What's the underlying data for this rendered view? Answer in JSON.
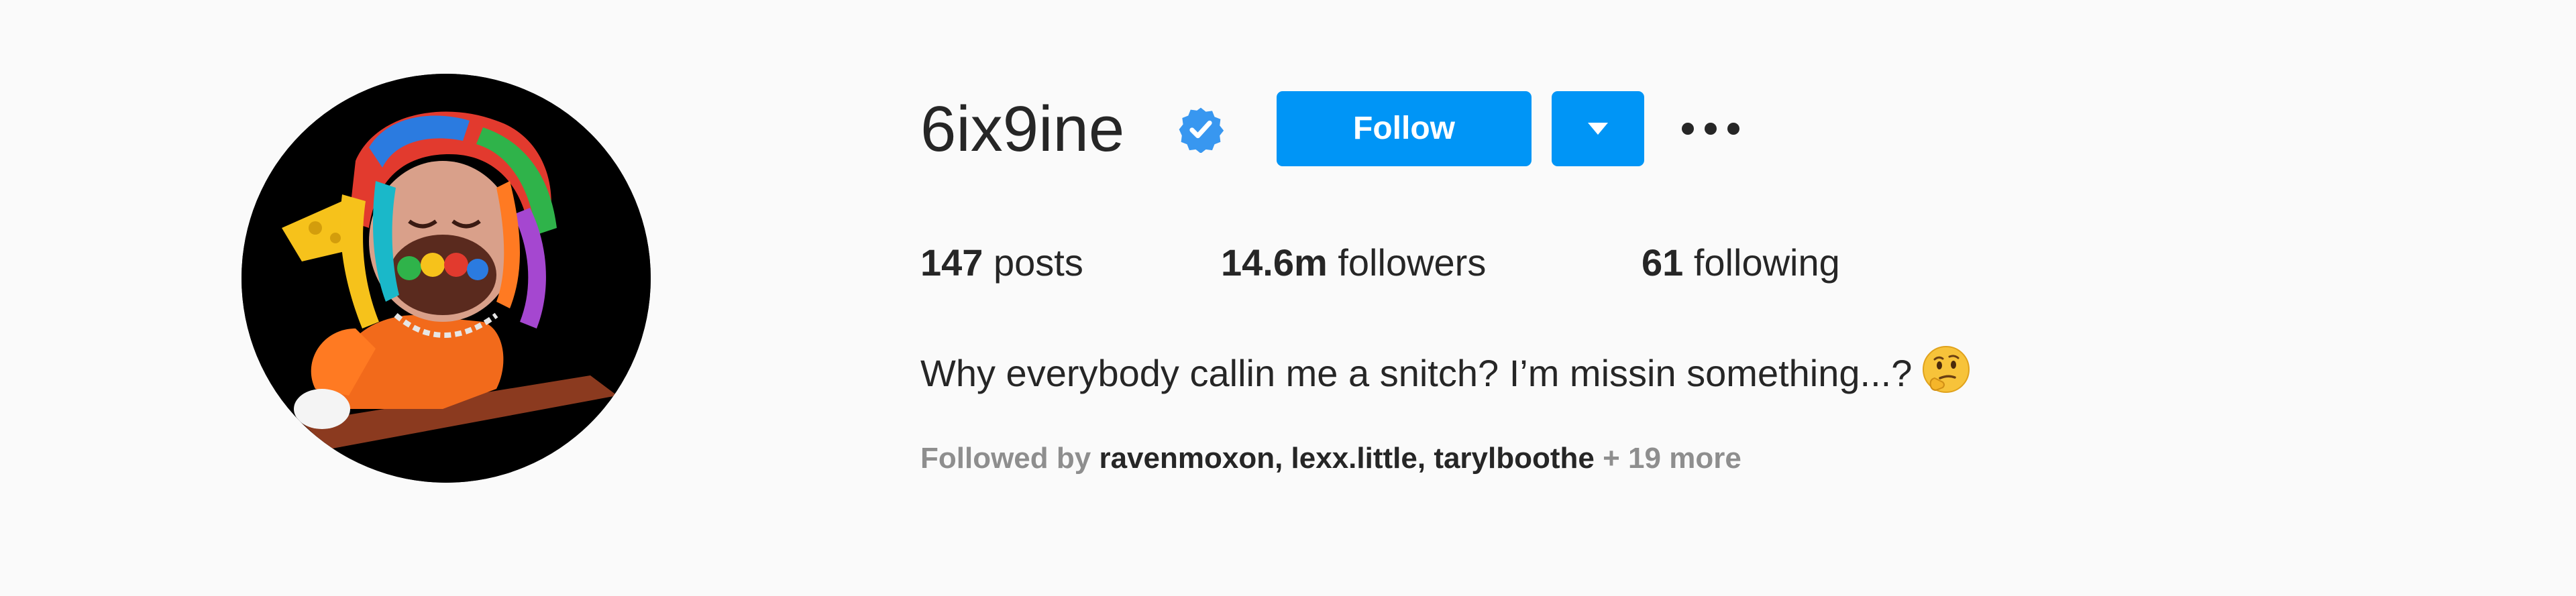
{
  "profile": {
    "username": "6ix9ine",
    "verified_icon": "verified-badge-icon",
    "follow_label": "Follow",
    "dropdown_icon": "caret-down-icon",
    "more_icon": "more-options-icon",
    "accent_color": "#0095f6"
  },
  "stats": {
    "posts_count": "147",
    "posts_label": " posts",
    "followers_count": "14.6m",
    "followers_label": " followers",
    "following_count": "61",
    "following_label": " following"
  },
  "bio": {
    "text": "Why everybody callin me a snitch? I’m missin something...?",
    "emoji_icon": "thinking-face-emoji"
  },
  "followed_by": {
    "prefix": "Followed by ",
    "users": [
      "ravenmoxon",
      "lexx.little",
      "tarylboothe"
    ],
    "separator": ", ",
    "more": " + 19 more"
  }
}
